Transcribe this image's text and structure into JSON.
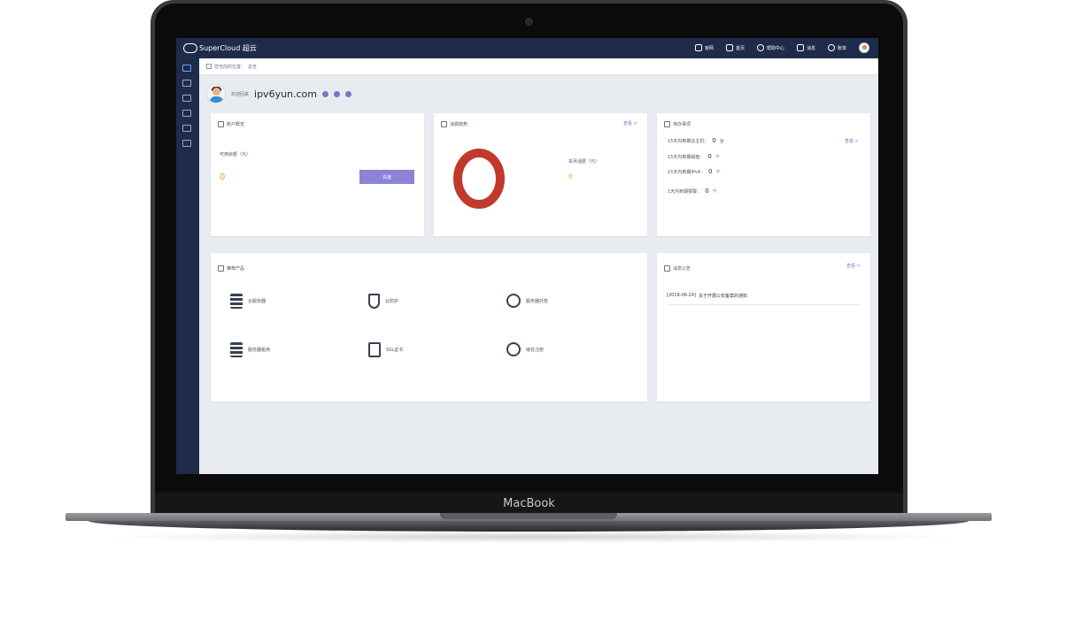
{
  "device": {
    "brand": "MacBook"
  },
  "header": {
    "logo_text": "SuperCloud 超云",
    "nav": [
      {
        "label": "官网",
        "icon": "monitor-icon"
      },
      {
        "label": "首页",
        "icon": "home-icon"
      },
      {
        "label": "帮助中心",
        "icon": "help-icon"
      },
      {
        "label": "消息",
        "icon": "mail-icon"
      },
      {
        "label": "账单",
        "icon": "yen-icon"
      }
    ]
  },
  "sidebar": {
    "items": [
      "home-icon",
      "user-icon",
      "grid-icon",
      "cube-icon",
      "calendar-icon",
      "list-icon"
    ]
  },
  "breadcrumb": {
    "prefix": "您当前的位置：",
    "current": "总览"
  },
  "welcome": {
    "label": "欢迎回来",
    "username": "ipv6yun.com"
  },
  "account_card": {
    "title": "账户概览",
    "balance_label": "可用余额（元）",
    "balance_value": "0",
    "recharge_label": "充值"
  },
  "cost_card": {
    "title": "消费趋势",
    "more": "查看 >",
    "month_label": "本月消费（元）",
    "month_value": "0"
  },
  "todo_card": {
    "title": "待办事项",
    "more": "查看 >",
    "rows": [
      {
        "label": "15天内到期云主机：",
        "value": "0",
        "unit": "台"
      },
      {
        "label": "15天内到期磁盘：",
        "value": "0",
        "unit": "个"
      },
      {
        "label": "15天内到期IPv4：",
        "value": "0",
        "unit": "个"
      },
      {
        "label": "1天内到期报警：",
        "value": "0",
        "unit": "个"
      }
    ]
  },
  "products_card": {
    "title": "推荐产品",
    "items": [
      {
        "label": "云服务器",
        "icon": "server-icon"
      },
      {
        "label": "云防护",
        "icon": "shield-icon"
      },
      {
        "label": "服务器托管",
        "icon": "hosting-icon"
      },
      {
        "label": "服务器租用",
        "icon": "rental-icon"
      },
      {
        "label": "SSL证书",
        "icon": "certificate-icon"
      },
      {
        "label": "域名注册",
        "icon": "www-icon"
      }
    ]
  },
  "notice_card": {
    "title": "消息公告",
    "more": "查看 >",
    "items": [
      {
        "date": "[2019-06-24]",
        "text": "关于开展公安备案的通知"
      }
    ]
  },
  "colors": {
    "primary": "#1e2b4a",
    "accent": "#8b84d6",
    "ring": "#c0392b",
    "highlight": "#f59e0b"
  }
}
